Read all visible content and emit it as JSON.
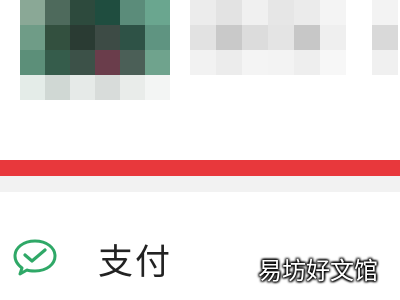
{
  "profile": {
    "avatar_colors": [
      [
        "#8aa896",
        "#4e6a5c",
        "#2d4a3d",
        "#1f4d3f",
        "#5b8c7a",
        "#6aa68f"
      ],
      [
        "#6f9c87",
        "#33503f",
        "#2a3b33",
        "#3d4b45",
        "#2e5246",
        "#5f9481"
      ],
      [
        "#5c8f79",
        "#355c4b",
        "#3c5148",
        "#6a3d4b",
        "#4b5f57",
        "#6fa38d"
      ],
      [
        "#e4ece8",
        "#d0d8d4",
        "#e6eae8",
        "#d8dcda",
        "#e9ecea",
        "#f3f5f4"
      ]
    ],
    "info_colors": [
      [
        "#ececec",
        "#e3e3e3",
        "#f0f0f0",
        "#e6e6e6",
        "#ebebeb",
        "#f4f4f4",
        "#ffffff",
        "#f3f3f3"
      ],
      [
        "#e2e2e2",
        "#c9c9c9",
        "#dcdcdc",
        "#e4e4e4",
        "#c7c7c7",
        "#efefef",
        "#ffffff",
        "#d9d9d9"
      ],
      [
        "#f2f2f2",
        "#ececec",
        "#f4f4f4",
        "#f3f3f3",
        "#eeeeee",
        "#f7f7f7",
        "#ffffff",
        "#f0f0f0"
      ]
    ]
  },
  "highlight": {
    "color": "#e8383c"
  },
  "pay": {
    "label": "支付",
    "icon": "wechat-pay-icon",
    "icon_color": "#2fa867"
  },
  "watermark": "易坊好文馆"
}
